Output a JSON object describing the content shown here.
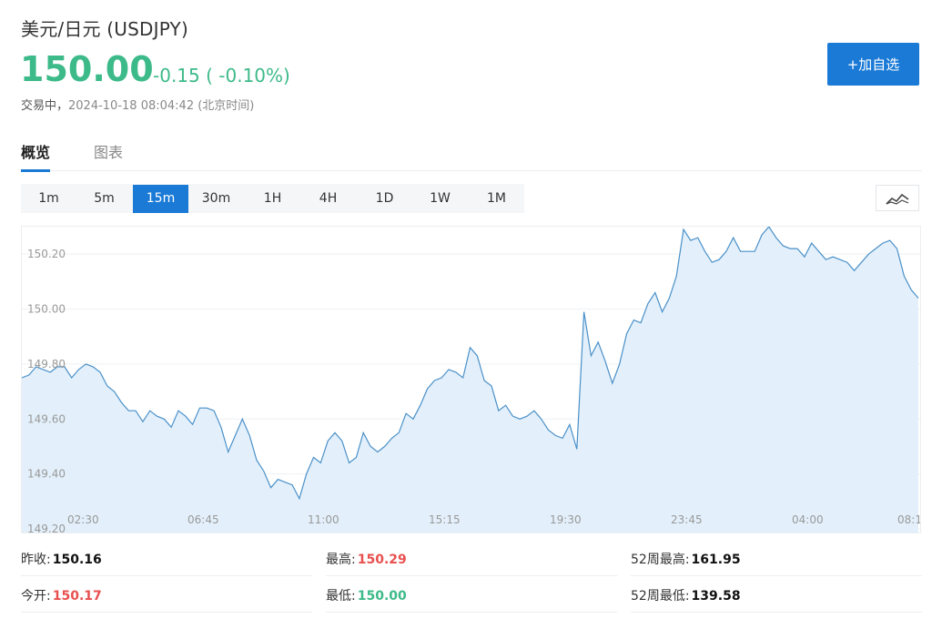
{
  "header": {
    "title": "美元/日元  (USDJPY)",
    "price": "150.00",
    "change": "-0.15 ( -0.10%)",
    "status_label": "交易中，",
    "timestamp": "2024-10-18 08:04:42",
    "timezone": "(北京时间)",
    "add_watchlist_label": "+加自选"
  },
  "tabs": [
    {
      "label": "概览",
      "active": true
    },
    {
      "label": "图表",
      "active": false
    }
  ],
  "intervals": [
    {
      "label": "1m"
    },
    {
      "label": "5m"
    },
    {
      "label": "15m",
      "active": true
    },
    {
      "label": "30m"
    },
    {
      "label": "1H"
    },
    {
      "label": "4H"
    },
    {
      "label": "1D"
    },
    {
      "label": "1W"
    },
    {
      "label": "1M"
    }
  ],
  "chart_data": {
    "type": "area",
    "x_ticks": [
      "02:30",
      "06:45",
      "11:00",
      "15:15",
      "19:30",
      "23:45",
      "04:00",
      "08:1"
    ],
    "y_ticks": [
      149.2,
      149.4,
      149.6,
      149.8,
      150.0,
      150.2
    ],
    "ylim": [
      149.18,
      150.3
    ],
    "y_tick_labels": [
      "149.20",
      "149.40",
      "149.60",
      "149.80",
      "150.00",
      "150.20"
    ],
    "grid": true,
    "values": [
      149.75,
      149.76,
      149.79,
      149.78,
      149.77,
      149.79,
      149.79,
      149.75,
      149.78,
      149.8,
      149.79,
      149.77,
      149.72,
      149.7,
      149.66,
      149.63,
      149.63,
      149.59,
      149.63,
      149.61,
      149.6,
      149.57,
      149.63,
      149.61,
      149.58,
      149.64,
      149.64,
      149.63,
      149.57,
      149.48,
      149.54,
      149.6,
      149.54,
      149.45,
      149.41,
      149.35,
      149.38,
      149.37,
      149.36,
      149.31,
      149.4,
      149.46,
      149.44,
      149.52,
      149.55,
      149.52,
      149.44,
      149.46,
      149.55,
      149.5,
      149.48,
      149.5,
      149.53,
      149.55,
      149.62,
      149.6,
      149.65,
      149.71,
      149.74,
      149.75,
      149.78,
      149.77,
      149.75,
      149.86,
      149.83,
      149.74,
      149.72,
      149.63,
      149.65,
      149.61,
      149.6,
      149.61,
      149.63,
      149.6,
      149.56,
      149.54,
      149.53,
      149.58,
      149.49,
      149.99,
      149.83,
      149.88,
      149.81,
      149.73,
      149.8,
      149.91,
      149.96,
      149.95,
      150.02,
      150.06,
      149.99,
      150.04,
      150.12,
      150.29,
      150.25,
      150.26,
      150.21,
      150.17,
      150.18,
      150.21,
      150.26,
      150.21,
      150.21,
      150.21,
      150.27,
      150.3,
      150.26,
      150.23,
      150.22,
      150.22,
      150.19,
      150.24,
      150.21,
      150.18,
      150.19,
      150.18,
      150.17,
      150.14,
      150.17,
      150.2,
      150.22,
      150.24,
      150.25,
      150.22,
      150.12,
      150.07,
      150.04
    ]
  },
  "stats": [
    [
      {
        "label": "昨收:",
        "value": "150.16",
        "tone": "neutral"
      },
      {
        "label": "最高:",
        "value": "150.29",
        "tone": "up"
      },
      {
        "label": "52周最高:",
        "value": "161.95",
        "tone": "neutral"
      }
    ],
    [
      {
        "label": "今开:",
        "value": "150.17",
        "tone": "up"
      },
      {
        "label": "最低:",
        "value": "150.00",
        "tone": "down"
      },
      {
        "label": "52周最低:",
        "value": "139.58",
        "tone": "neutral"
      }
    ]
  ],
  "colors": {
    "accent": "#1a7ad6",
    "down": "#3dba89",
    "up": "#e8504f",
    "line": "#4a90c8",
    "fill": "#e3f0fb"
  }
}
